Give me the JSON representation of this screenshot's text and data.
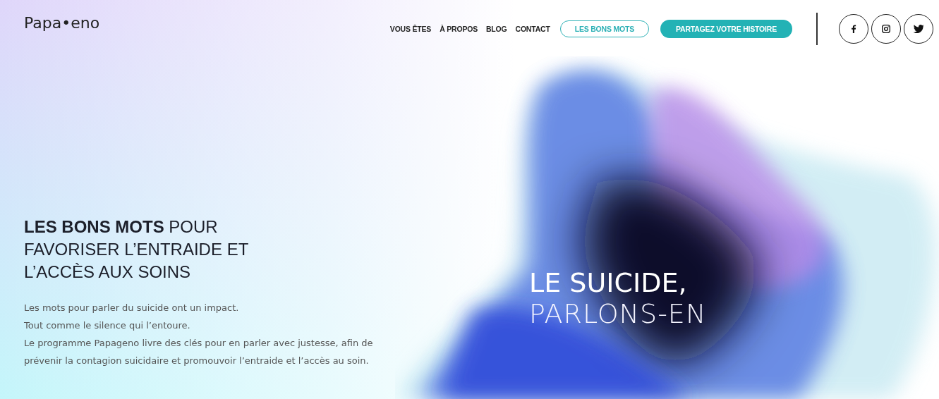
{
  "header": {
    "logo": "Papa•eno",
    "nav": [
      {
        "label": "VOUS ÊTES",
        "kind": "link"
      },
      {
        "label": "À PROPOS",
        "kind": "link"
      },
      {
        "label": "BLOG",
        "kind": "link"
      },
      {
        "label": "CONTACT",
        "kind": "link"
      },
      {
        "label": "LES BONS MOTS",
        "kind": "outline"
      },
      {
        "label": "PARTAGEZ VOTRE HISTOIRE",
        "kind": "filled"
      }
    ],
    "social": [
      {
        "kind": "facebook"
      },
      {
        "kind": "instagram"
      },
      {
        "kind": "twitter"
      }
    ]
  },
  "hero": {
    "headline": "**LES BONS MOTS** POUR FAVORISER L’ENTRAIDE ET L’ACCÈS AUX SOINS",
    "paragraphs": [
      "Les mots pour parler du suicide ont un impact.",
      "Tout comme le silence qui l’entoure.",
      "Le programme Papageno livre des clés pour en parler avec justesse, afin de prévenir la contagion suicidaire et promouvoir l’entraide et l’accès au soin."
    ],
    "title_lines": [
      "LE SUICIDE,",
      "PARLONS-EN"
    ]
  }
}
